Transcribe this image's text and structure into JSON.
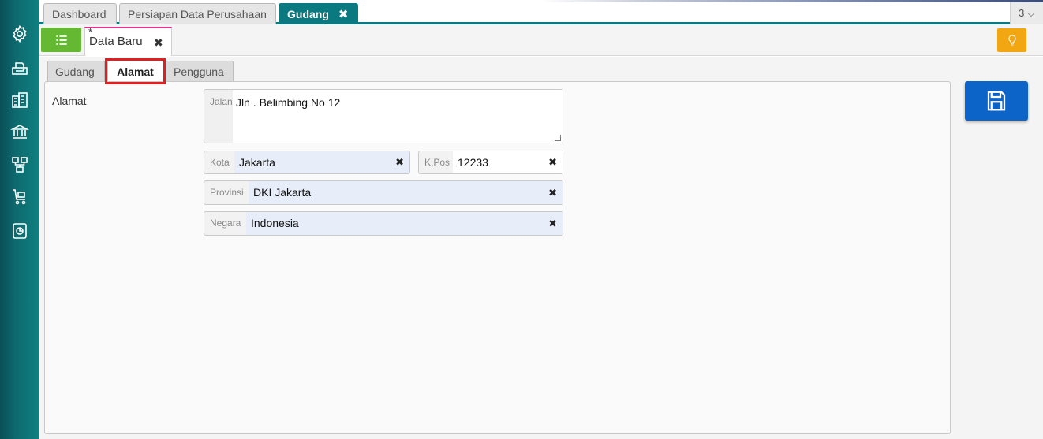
{
  "tabs": [
    {
      "label": "Dashboard"
    },
    {
      "label": "Persiapan Data Perusahaan"
    },
    {
      "label": "Gudang",
      "close": "✖"
    }
  ],
  "tab_count": "3 ⌵",
  "doc_tab": {
    "star": "*",
    "label": "Data Baru",
    "close": "✖"
  },
  "form_tabs": [
    {
      "label": "Gudang"
    },
    {
      "label": "Alamat"
    },
    {
      "label": "Pengguna"
    }
  ],
  "section_label": "Alamat",
  "fields": {
    "jalan": {
      "label": "Jalan",
      "value": "Jln . Belimbing No 12"
    },
    "kota": {
      "label": "Kota",
      "value": "Jakarta",
      "clear": "✖"
    },
    "kpos": {
      "label": "K.Pos",
      "value": "12233",
      "clear": "✖"
    },
    "provinsi": {
      "label": "Provinsi",
      "value": "DKI Jakarta",
      "clear": "✖"
    },
    "negara": {
      "label": "Negara",
      "value": "Indonesia",
      "clear": "✖"
    }
  },
  "icons": {
    "sidebar": [
      "gear-icon",
      "printer-icon",
      "building-icon",
      "bank-icon",
      "network-icon",
      "cart-icon",
      "report-icon"
    ],
    "menu": "list-icon",
    "hint": "lightbulb-icon",
    "save": "floppy-disk-icon"
  },
  "colors": {
    "sidebar": "#0d6a6e",
    "active_tab": "#0b7a80",
    "menu_button": "#65b832",
    "hint_button": "#f2a712",
    "save_button": "#0c64c8",
    "highlight": "#e02020"
  }
}
